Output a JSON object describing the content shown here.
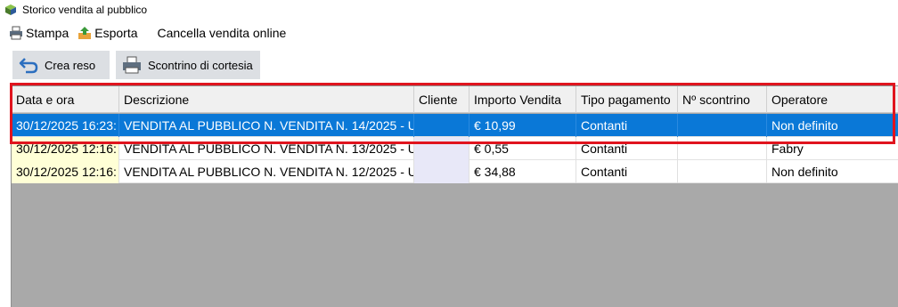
{
  "window": {
    "title": "Storico vendita al pubblico"
  },
  "menu": {
    "stampa": "Stampa",
    "esporta": "Esporta",
    "cancella": "Cancella vendita online"
  },
  "toolbar": {
    "crea_reso": "Crea reso",
    "scontrino": "Scontrino di cortesia"
  },
  "table": {
    "columns": [
      "Data e ora",
      "Descrizione",
      "Cliente",
      "Importo Vendita",
      "Tipo pagamento",
      "Nº scontrino",
      "Operatore"
    ],
    "rows": [
      {
        "data": "30/12/2025 16:23:",
        "descrizione": "VENDITA AL PUBBLICO N. VENDITA N. 14/2025 - U",
        "cliente": "",
        "importo": "€ 10,99",
        "tipo": "Contanti",
        "scontrino": "",
        "operatore": "Non definito",
        "selected": true
      },
      {
        "data": "30/12/2025 12:16:",
        "descrizione": "VENDITA AL PUBBLICO N. VENDITA N. 13/2025 - U",
        "cliente": "",
        "importo": "€ 0,55",
        "tipo": "Contanti",
        "scontrino": "",
        "operatore": "Fabry",
        "selected": false
      },
      {
        "data": "30/12/2025 12:16:",
        "descrizione": "VENDITA AL PUBBLICO N. VENDITA N. 12/2025 - U",
        "cliente": "",
        "importo": "€ 34,88",
        "tipo": "Contanti",
        "scontrino": "",
        "operatore": "Non definito",
        "selected": false
      }
    ]
  },
  "colors": {
    "selection": "#0a78d7",
    "highlight": "#e0141e",
    "grid_bg": "#a9a9a9"
  },
  "icons": {
    "app": "app-cube-icon",
    "stampa": "printer-icon",
    "esporta": "export-icon",
    "reso": "undo-arrow-icon",
    "scontrino": "receipt-printer-icon"
  }
}
